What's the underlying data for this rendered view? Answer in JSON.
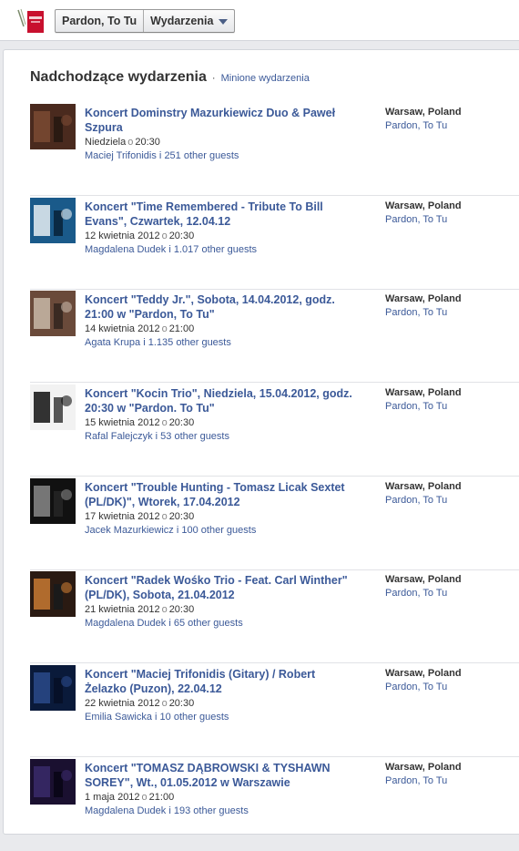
{
  "header": {
    "page_name": "Pardon, To Tu",
    "section": "Wydarzenia"
  },
  "main": {
    "title": "Nadchodzące wydarzenia",
    "separator": "·",
    "past_link": "Minione wydarzenia",
    "events": [
      {
        "title": "Koncert Dominstry Mazurkiewicz Duo & Paweł Szpura",
        "date": "Niedziela",
        "time": "20:30",
        "host": "Maciej Trifonidis",
        "guests": "251 other guests",
        "city": "Warsaw, Poland",
        "venue": "Pardon, To Tu"
      },
      {
        "title": "Koncert \"Time Remembered - Tribute To Bill Evans\", Czwartek, 12.04.12",
        "date": "12 kwietnia 2012",
        "time": "20:30",
        "host": "Magdalena Dudek",
        "guests": "1.017 other guests",
        "city": "Warsaw, Poland",
        "venue": "Pardon, To Tu"
      },
      {
        "title": "Koncert \"Teddy Jr.\", Sobota, 14.04.2012, godz. 21:00 w \"Pardon, To Tu\"",
        "date": "14 kwietnia 2012",
        "time": "21:00",
        "host": "Agata Krupa",
        "guests": "1.135 other guests",
        "city": "Warsaw, Poland",
        "venue": "Pardon, To Tu"
      },
      {
        "title": "Koncert \"Kocin Trio\", Niedziela, 15.04.2012, godz. 20:30 w \"Pardon. To Tu\"",
        "date": "15 kwietnia 2012",
        "time": "20:30",
        "host": "Rafal Falejczyk",
        "guests": "53 other guests",
        "city": "Warsaw, Poland",
        "venue": "Pardon, To Tu"
      },
      {
        "title": "Koncert \"Trouble Hunting - Tomasz Licak Sextet (PL/DK)\", Wtorek, 17.04.2012",
        "date": "17 kwietnia 2012",
        "time": "20:30",
        "host": "Jacek Mazurkiewicz",
        "guests": "100 other guests",
        "city": "Warsaw, Poland",
        "venue": "Pardon, To Tu"
      },
      {
        "title": "Koncert \"Radek Wośko Trio - Feat. Carl Winther\" (PL/DK), Sobota, 21.04.2012",
        "date": "21 kwietnia 2012",
        "time": "20:30",
        "host": "Magdalena Dudek",
        "guests": "65 other guests",
        "city": "Warsaw, Poland",
        "venue": "Pardon, To Tu"
      },
      {
        "title": "Koncert \"Maciej Trifonidis (Gitary) / Robert Żelazko (Puzon), 22.04.12",
        "date": "22 kwietnia 2012",
        "time": "20:30",
        "host": "Emilia Sawicka",
        "guests": "10 other guests",
        "city": "Warsaw, Poland",
        "venue": "Pardon, To Tu"
      },
      {
        "title": "Koncert \"TOMASZ DĄBROWSKI & TYSHAWN SOREY\", Wt., 01.05.2012 w Warszawie",
        "date": "1 maja 2012",
        "time": "21:00",
        "host": "Magdalena Dudek",
        "guests": "193 other guests",
        "city": "Warsaw, Poland",
        "venue": "Pardon, To Tu"
      }
    ],
    "dot": "o",
    "conj": "i"
  },
  "colors": {
    "link": "#3b5998",
    "page_bg": "#e9eaed"
  }
}
